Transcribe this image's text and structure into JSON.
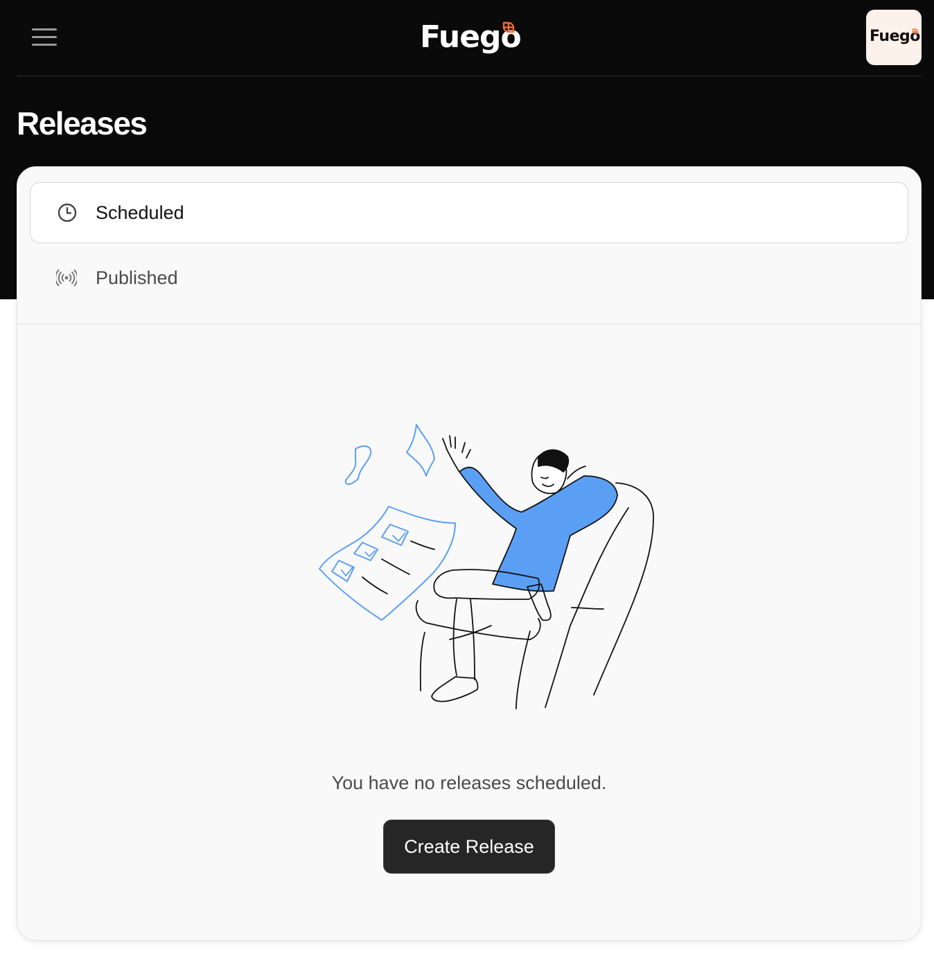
{
  "header": {
    "logo_text": "Fuego",
    "avatar_text": "Fuego",
    "menu_icon": "hamburger-menu-icon",
    "accent_color": "#f06a35"
  },
  "page": {
    "title": "Releases"
  },
  "tabs": [
    {
      "label": "Scheduled",
      "icon": "clock-icon",
      "active": true
    },
    {
      "label": "Published",
      "icon": "broadcast-icon",
      "active": false
    }
  ],
  "empty_state": {
    "illustration": "person-relaxing-in-armchair-with-flying-checklist-papers",
    "message": "You have no releases scheduled.",
    "button_label": "Create Release"
  },
  "colors": {
    "header_background": "#0a0a0a",
    "card_background": "#f9f9f9",
    "button_background": "#262626",
    "illustration_accent": "#5b9ff5"
  }
}
